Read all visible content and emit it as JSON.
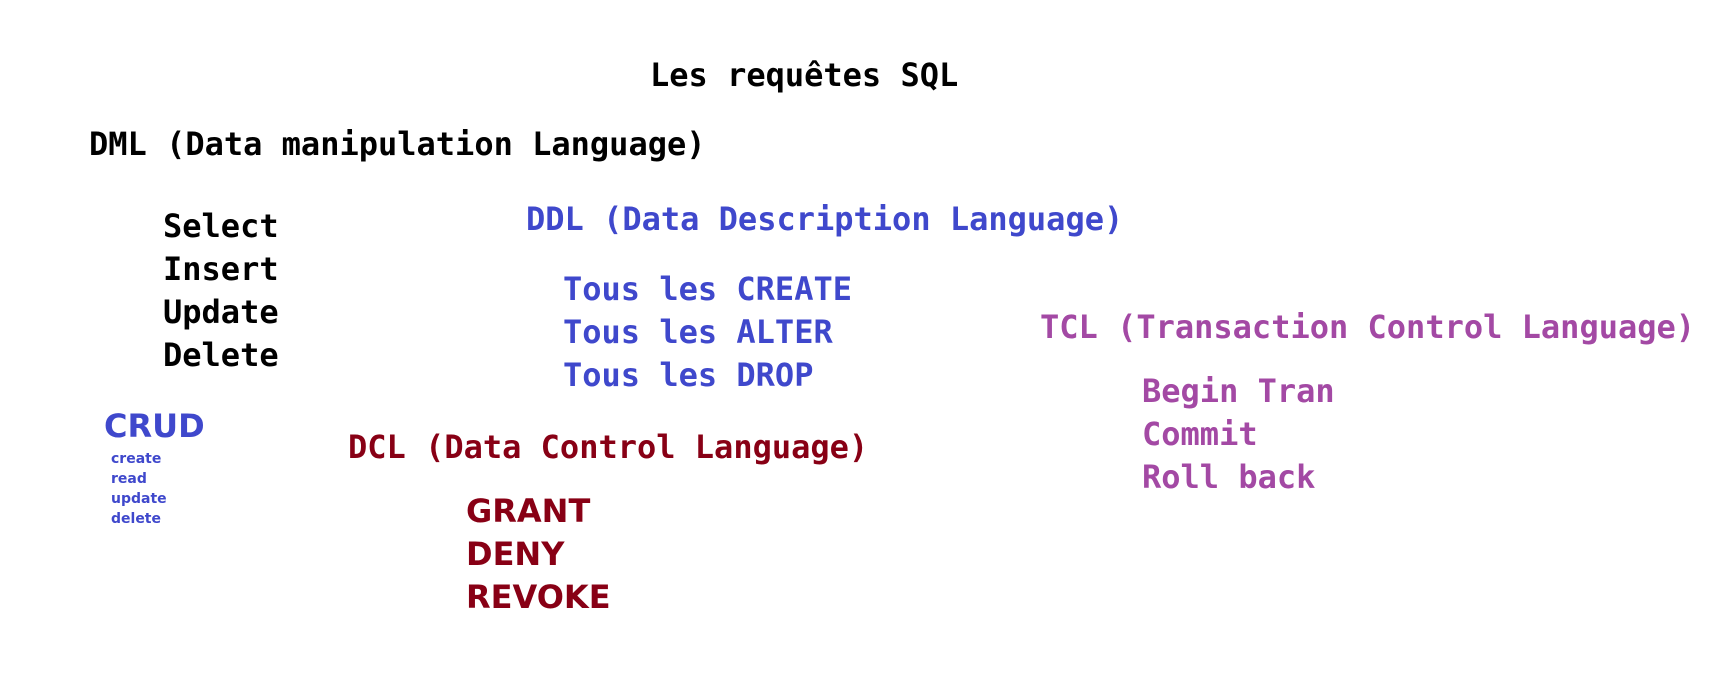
{
  "title": "Les requêtes SQL",
  "colors": {
    "black": "#000000",
    "ddl": "#3f48cc",
    "dcl": "#880015",
    "tcl": "#a349a4",
    "crud": "#3f48cc"
  },
  "dml": {
    "heading": "DML (Data manipulation Language)",
    "items": [
      "Select",
      "Insert",
      "Update",
      "Delete"
    ]
  },
  "ddl": {
    "heading": "DDL (Data Description Language)",
    "items": [
      "Tous les CREATE",
      "Tous les ALTER",
      "Tous les DROP"
    ]
  },
  "tcl": {
    "heading": "TCL (Transaction Control Language)",
    "items": [
      "Begin Tran",
      "Commit",
      "Roll back"
    ]
  },
  "crud": {
    "heading": "CRUD",
    "items": [
      "create",
      "read",
      "update",
      "delete"
    ]
  },
  "dcl": {
    "heading": "DCL (Data Control Language)",
    "items": [
      "GRANT",
      "DENY",
      "REVOKE"
    ]
  }
}
